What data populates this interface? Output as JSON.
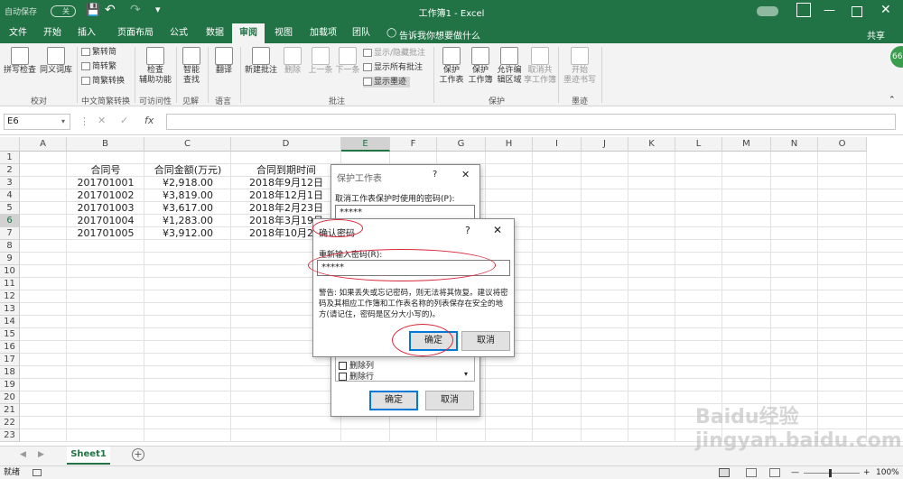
{
  "titlebar": {
    "autosave_label": "自动保存",
    "autosave_state": "关",
    "title": "工作簿1 - Excel"
  },
  "menu": {
    "tabs": [
      "文件",
      "开始",
      "插入",
      "页面布局",
      "公式",
      "数据",
      "审阅",
      "视图",
      "加载项",
      "团队"
    ],
    "active": "审阅",
    "tell_me": "告诉我你想要做什么",
    "share": "共享"
  },
  "ribbon": {
    "spell": "拼写检查",
    "thesaurus": "同义词库",
    "group_proofing": "校对",
    "trad": "繁转简",
    "simp": "简转繁",
    "convert": "简繁转换",
    "group_chinese": "中文简繁转换",
    "check_access": "检查\n辅助功能",
    "group_access": "可访问性",
    "smart": "智能\n查找",
    "group_insights": "见解",
    "translate": "翻译",
    "group_lang": "语言",
    "new_comment": "新建批注",
    "delete": "删除",
    "prev": "上一条",
    "next": "下一条",
    "show_hide": "显示/隐藏批注",
    "show_all": "显示所有批注",
    "show_ink": "显示墨迹",
    "group_comments": "批注",
    "protect_sheet": "保护\n工作表",
    "protect_book": "保护\n工作簿",
    "allow_edit": "允许编\n辑区域",
    "unshare": "取消共\n享工作簿",
    "group_protect": "保护",
    "start_ink": "开始\n墨迹书写",
    "group_ink": "墨迹"
  },
  "formula": {
    "namebox": "E6",
    "fx": "fx"
  },
  "grid": {
    "columns": [
      "A",
      "B",
      "C",
      "D",
      "E",
      "F",
      "G",
      "H",
      "I",
      "J",
      "K",
      "L",
      "M",
      "N",
      "O"
    ],
    "rows": [
      "1",
      "2",
      "3",
      "4",
      "5",
      "6",
      "7",
      "8",
      "9",
      "10",
      "11",
      "12",
      "13",
      "14",
      "15",
      "16",
      "17",
      "18",
      "19",
      "20",
      "21",
      "22",
      "23"
    ],
    "headers": [
      "合同号",
      "合同金额(万元)",
      "合同到期时间"
    ],
    "data": [
      [
        "201701001",
        "¥2,918.00",
        "2018年9月12日"
      ],
      [
        "201701002",
        "¥3,819.00",
        "2018年12月1日"
      ],
      [
        "201701003",
        "¥3,617.00",
        "2018年2月23日"
      ],
      [
        "201701004",
        "¥1,283.00",
        "2018年3月19日"
      ],
      [
        "201701005",
        "¥3,912.00",
        "2018年10月2日"
      ]
    ]
  },
  "protect_dialog": {
    "title": "保护工作表",
    "question": "?",
    "close": "✕",
    "label": "取消工作表保护时使用的密码(P):",
    "password": "*****",
    "opt1": "删除列",
    "opt2": "删除行",
    "ok": "确定",
    "cancel": "取消"
  },
  "confirm_dialog": {
    "title": "确认密码",
    "question": "?",
    "close": "✕",
    "label": "重新输入密码(R):",
    "password": "*****",
    "warning": "警告: 如果丢失或忘记密码，则无法将其恢复。建议将密码及其相应工作簿和工作表名称的列表保存在安全的地方(请记住，密码是区分大小写的)。",
    "ok": "确定",
    "cancel": "取消"
  },
  "sheet": {
    "tab": "Sheet1",
    "add": "+"
  },
  "status": {
    "ready": "就绪",
    "zoom": "100%"
  },
  "watermark": "Baidu经验 jingyan.baidu.com",
  "colors": {
    "excel_green": "#217346",
    "annotation_red": "#d9263a"
  }
}
